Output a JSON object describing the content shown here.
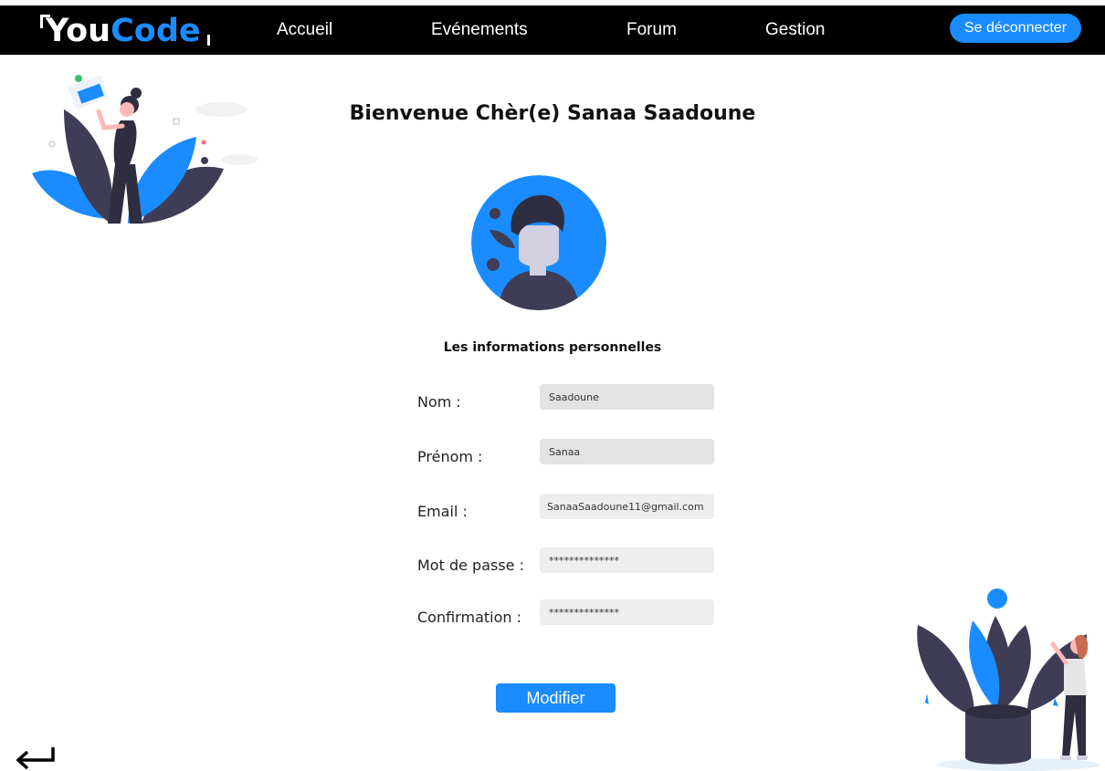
{
  "brand": {
    "you": "You",
    "code": "Code"
  },
  "nav": {
    "links": [
      "Accueil",
      "Evénements",
      "Forum",
      "Gestion"
    ],
    "logout_label": "Se déconnecter"
  },
  "page": {
    "welcome": "Bienvenue Chèr(e) Sanaa Saadoune",
    "section_title": "Les informations personnelles"
  },
  "form": {
    "fields": [
      {
        "label": "Nom :",
        "value": "Saadoune"
      },
      {
        "label": "Prénom :",
        "value": "Sanaa"
      },
      {
        "label": "Email :",
        "value": "SanaaSaadoune11@gmail.com"
      },
      {
        "label": "Mot de passe :",
        "value": "**************"
      },
      {
        "label": "Confirmation :",
        "value": "**************"
      }
    ],
    "submit_label": "Modifier"
  },
  "colors": {
    "accent": "#1a8cff",
    "nav_bg": "#000000",
    "dark_illustration": "#3f3d56"
  },
  "icons": {
    "back": "return-arrow-icon",
    "avatar": "user-avatar-icon"
  }
}
